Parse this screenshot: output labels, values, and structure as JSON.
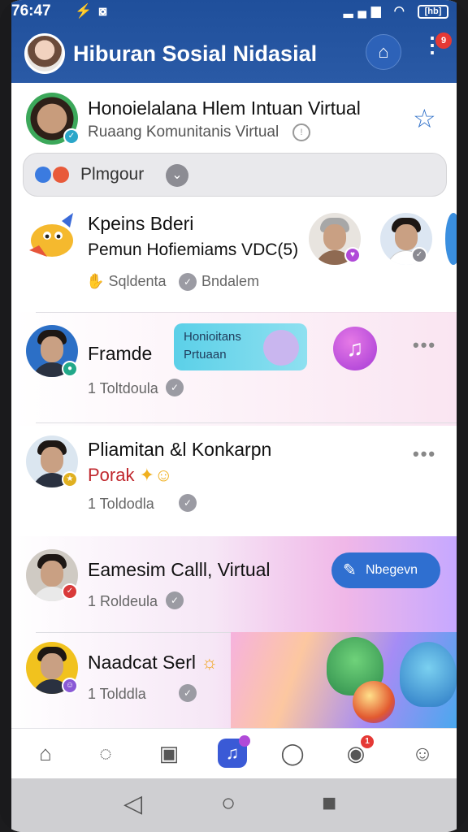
{
  "status_bar": {
    "time": "76:47",
    "battery": "[hb]"
  },
  "header": {
    "title": "Hiburan Sosial Nidasial",
    "notification_count": "9"
  },
  "featured": {
    "title": "Honoielalana Hlem Intuan Virtual",
    "subtitle": "Ruaang Komunitanis Virtual"
  },
  "search": {
    "label": "Plmgour"
  },
  "rows": [
    {
      "name": "Kpeins Bderi",
      "line2": "Pemun Hofiemiams VDC(5)",
      "meta_a": "Sqldenta",
      "meta_b": "Bndalem"
    },
    {
      "name": "Framde",
      "meta": "1 Toltdoula",
      "card_line1": "Honioitans",
      "card_line2": "Prtuaan"
    },
    {
      "name": "Pliamitan &l Konkarpn",
      "line2": "Porak",
      "meta": "1 Toldodla"
    },
    {
      "name": "Eamesim Calll, Virtual",
      "meta": "1 Roldeula",
      "button": "Nbegevn"
    },
    {
      "name": "Naadcat Serl",
      "meta": "1 Tolddla"
    }
  ],
  "colors": {
    "header": "#1f4f9b",
    "accent": "#2f6fd0",
    "badge": "#e53935"
  },
  "icons": {
    "nav": [
      "home-icon",
      "activity-icon",
      "contacts-icon",
      "music-icon",
      "chat-icon",
      "messages-icon",
      "profile-icon"
    ]
  }
}
